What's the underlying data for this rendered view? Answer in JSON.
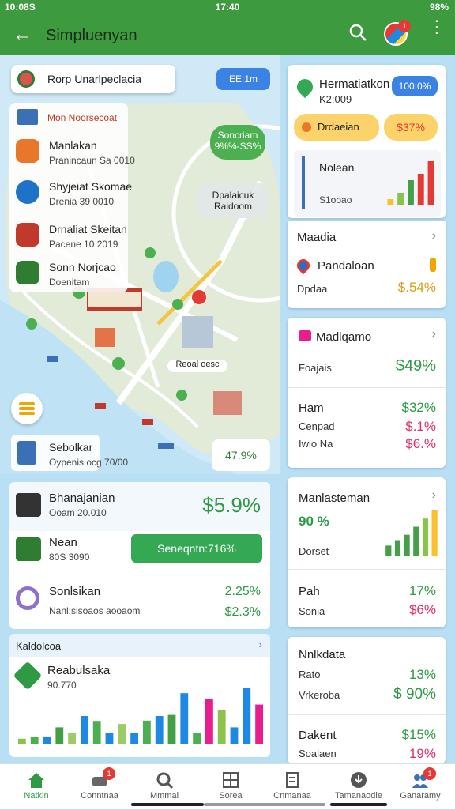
{
  "status": {
    "time_left": "10:08S",
    "time_center": "17:40",
    "battery": "98%"
  },
  "appbar": {
    "title": "Simpluenyan",
    "avatar_badge": "1"
  },
  "map": {
    "search_text": "Rorp Unarlpeclacia",
    "blue_pill": "EE:1m",
    "list_header": "Mon Noorsecoat",
    "items": [
      {
        "title": "Manlakan",
        "sub": "Pranincaun Sa 0010",
        "color": "#e9772a"
      },
      {
        "title": "Shyjeiat Skomae",
        "sub": "Drenia 39 0010",
        "color": "#1e73c8"
      },
      {
        "title": "Drnaliat Skeitan",
        "sub": "Pacene 10 2019",
        "color": "#c0392b"
      },
      {
        "title": "Sonn Norjcao",
        "sub": "Doenitam",
        "color": "#2e7d32"
      }
    ],
    "bubble_green": {
      "line1": "Soncriam",
      "line2": "9%%-SS%"
    },
    "bubble_grey": {
      "line1": "Dpalaicuk",
      "line2": "Raidoom"
    },
    "place_label": "Reoal oesc",
    "bottom_card": {
      "title": "Sebolkar",
      "sub": "Oypenis ocg 70/00"
    },
    "bottom_pct": "47.9%"
  },
  "left_panel": {
    "rows": [
      {
        "title": "Bhanajanian",
        "sub": "Ooam 20.010",
        "value": "$5.9%"
      },
      {
        "title": "Nean",
        "sub": "80S 3090",
        "button": "Seneqntn:716%"
      },
      {
        "title": "Sonlsikan",
        "sub": "Nanl:sisoaos aooaom",
        "v1": "2.25%",
        "v2": "$2.3%"
      }
    ]
  },
  "bottom_panel": {
    "header": "Kaldolcoa",
    "title": "Reabulsaka",
    "sub": "90.770"
  },
  "right": {
    "card1": {
      "title": "Hermatiatkon",
      "sub": "K2:009",
      "pill_blue": "100:0%",
      "pill_orange": "Drdaeian",
      "pill_yellow": "$37%",
      "inner_title": "Nolean",
      "inner_sub": "S1ooao"
    },
    "card1b": {
      "title": "Maadia",
      "row_title": "Pandaloan",
      "row_sub": "Dpdaa",
      "row_value": "$.54%"
    },
    "card2": {
      "title": "Madlqamo",
      "row1_label": "Foajais",
      "row1_value": "$49%",
      "row2_label": "Ham",
      "row2_value": "$32%",
      "row3_label": "Cenpad",
      "row3_value": "$.1%",
      "row4_label": "Iwio Na",
      "row4_value": "$6.%"
    },
    "card3": {
      "title": "Manlasteman",
      "big": "90 %",
      "sub": "Dorset",
      "row1_label": "Pah",
      "row1_value": "17%",
      "row2_label": "Sonia",
      "row2_value": "$6%"
    },
    "card4": {
      "title": "Nnlkdata",
      "row1_label": "Rato",
      "row1_value": "13%",
      "row2_label": "Vrkeroba",
      "row2_value": "$ 90%",
      "row3_label": "Dakent",
      "row3_value": "$15%",
      "row4_label": "Soalaen",
      "row4_value": "19%"
    }
  },
  "nav": [
    {
      "label": "Natkin",
      "badge": ""
    },
    {
      "label": "Conntnaa",
      "badge": "1"
    },
    {
      "label": "Mmmal",
      "badge": ""
    },
    {
      "label": "Sorea",
      "badge": ""
    },
    {
      "label": "Cnmanaa",
      "badge": ""
    },
    {
      "label": "Tamanaodle",
      "badge": ""
    },
    {
      "label": "Ganaramy",
      "badge": "1"
    }
  ],
  "chart_data": [
    {
      "type": "bar",
      "title": "",
      "categories": [
        "1",
        "2",
        "3",
        "4",
        "5",
        "6",
        "7",
        "8",
        "9",
        "10",
        "11",
        "12",
        "13",
        "14",
        "15",
        "16",
        "17",
        "18",
        "19",
        "20"
      ],
      "values": [
        10,
        14,
        14,
        30,
        20,
        50,
        40,
        20,
        36,
        20,
        42,
        50,
        52,
        90,
        20,
        80,
        60,
        30,
        100,
        70
      ],
      "colors": [
        "#8bc34a",
        "#4caf50",
        "#1e88e5",
        "#43a047",
        "#9ccc65",
        "#1e88e5",
        "#4caf50",
        "#1e88e5",
        "#9ccc65",
        "#1e88e5",
        "#4caf50",
        "#1e88e5",
        "#43a047",
        "#1e88e5",
        "#4caf50",
        "#e91e8c",
        "#8bc34a",
        "#1e88e5",
        "#1e88e5",
        "#e91e8c"
      ]
    },
    {
      "type": "bar",
      "title": "",
      "categories": [
        "1",
        "2",
        "3",
        "4",
        "5"
      ],
      "values": [
        10,
        20,
        40,
        50,
        70
      ],
      "colors": [
        "#fbc02d",
        "#8bc34a",
        "#43a047",
        "#e53935",
        "#e53935"
      ]
    },
    {
      "type": "bar",
      "title": "",
      "categories": [
        "1",
        "2",
        "3",
        "4",
        "5",
        "6"
      ],
      "values": [
        20,
        30,
        40,
        55,
        70,
        85
      ],
      "colors": [
        "#43a047",
        "#43a047",
        "#43a047",
        "#43a047",
        "#8bc34a",
        "#fbc02d"
      ]
    }
  ]
}
